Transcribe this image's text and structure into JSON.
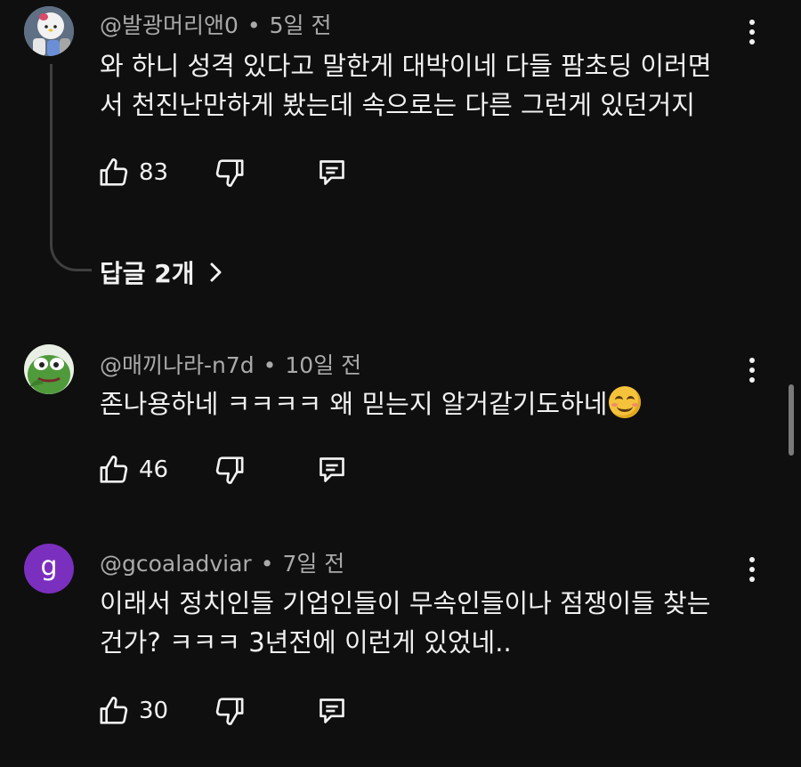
{
  "comments": [
    {
      "author": "@발광머리앤0",
      "time": "5일 전",
      "lines": [
        "와 하니 성격 있다고 말한게 대박이네 다들 팜초딩 이러면",
        "서 천진난만하게 봤는데 속으로는 다른 그런게 있던거지"
      ],
      "likes": "83",
      "replies_label": "답글 2개"
    },
    {
      "author": "@매끼나라-n7d",
      "time": "10일 전",
      "lines": [
        "존나용하네 ㅋㅋㅋㅋ 왜 믿는지 알거같기도하네"
      ],
      "emoji": "smiling-face",
      "likes": "46"
    },
    {
      "author": "@gcoaladviar",
      "time": "7일 전",
      "avatar_letter": "g",
      "avatar_color": "#7b2fbe",
      "lines": [
        "이래서 정치인들 기업인들이 무속인들이나 점쟁이들 찾는",
        "건가? ㅋㅋㅋ 3년전에 이런게 있었네.."
      ],
      "likes": "30"
    }
  ],
  "separator": "•",
  "icons": {
    "like": "thumbs-up-icon",
    "dislike": "thumbs-down-icon",
    "reply": "comment-icon",
    "more": "more-vert-icon",
    "chevron": "chevron-right-icon"
  }
}
